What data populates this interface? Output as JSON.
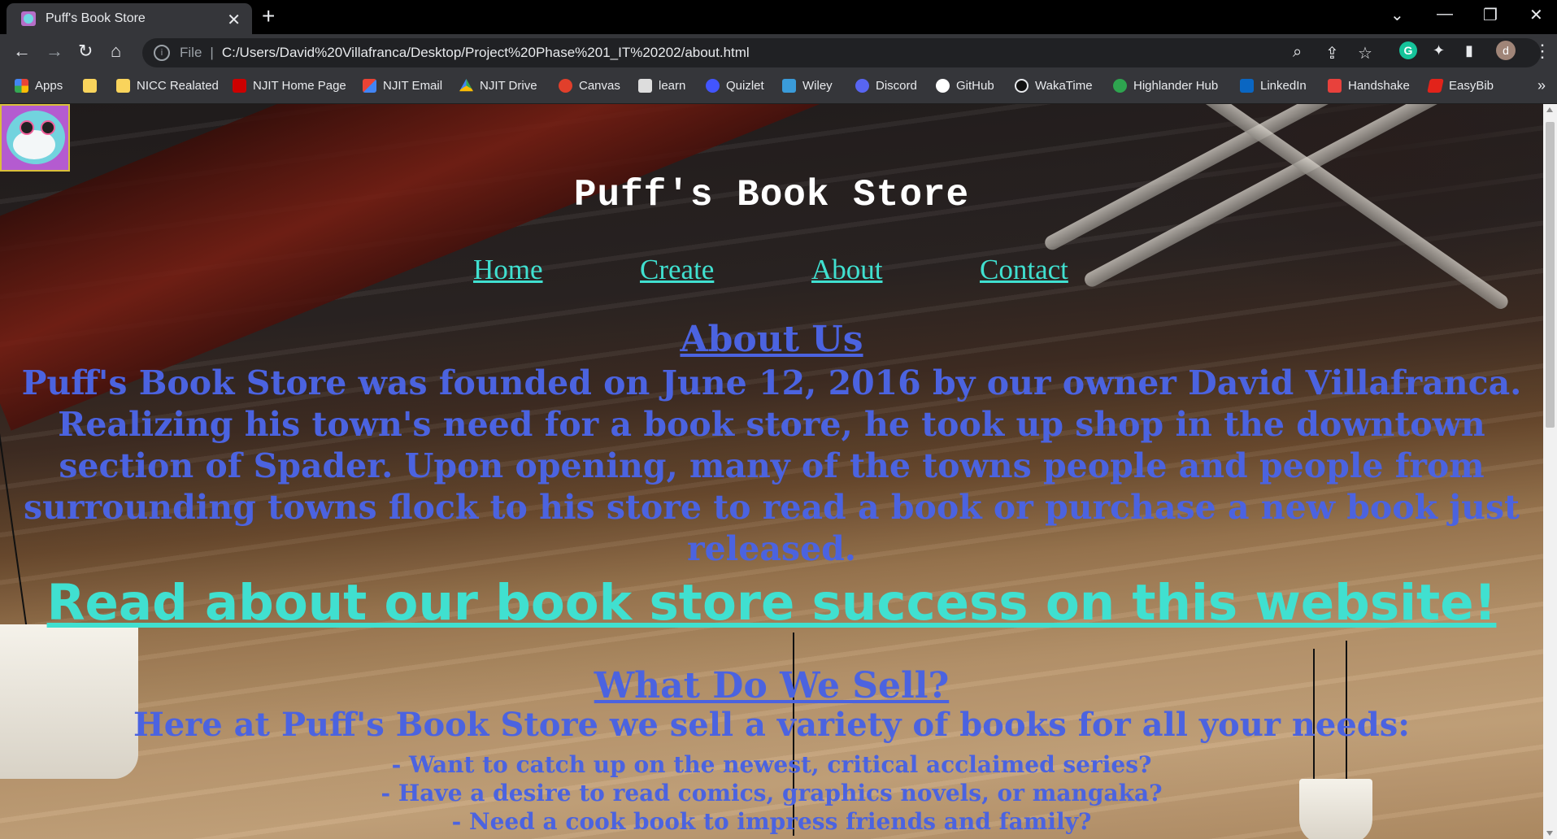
{
  "browser": {
    "tab": {
      "title": "Puff's Book Store",
      "close": "✕",
      "favicon": "pufferfish-favicon"
    },
    "new_tab": "+",
    "window_controls": {
      "dropdown": "⌄",
      "minimize": "—",
      "restore": "❐",
      "close": "✕"
    },
    "toolbar": {
      "back": "←",
      "forward": "→",
      "reload": "↻",
      "home": "⌂",
      "info": "i",
      "scheme": "File",
      "separator": "|",
      "url": "C:/Users/David%20Villafranca/Desktop/Project%20Phase%201_IT%20202/about.html",
      "zoom_icon": "⌕",
      "share_icon": "⇪",
      "star_icon": "☆",
      "grammarly": "G",
      "extensions_icon": "✦",
      "sidepanel_icon": "▮",
      "avatar": "d",
      "menu": "⋮"
    },
    "bookmarks": [
      {
        "label": "Apps",
        "icon": "apps-grid-icon",
        "color": "#e94235"
      },
      {
        "label": "",
        "icon": "folder-icon",
        "color": "#f9d45c"
      },
      {
        "label": "NICC Realated",
        "icon": "folder-icon",
        "color": "#f9d45c"
      },
      {
        "label": "NJIT Home Page",
        "icon": "njit-icon",
        "color": "#cc0000"
      },
      {
        "label": "NJIT Email",
        "icon": "gmail-icon",
        "color": "#ea4335"
      },
      {
        "label": "NJIT Drive",
        "icon": "drive-icon",
        "color": "#34a853"
      },
      {
        "label": "Canvas",
        "icon": "canvas-icon",
        "color": "#e13f2b"
      },
      {
        "label": "learn",
        "icon": "learn-icon",
        "color": "#dddddd"
      },
      {
        "label": "Quizlet",
        "icon": "quizlet-icon",
        "color": "#4255ff"
      },
      {
        "label": "Wiley",
        "icon": "wiley-icon",
        "color": "#3a9bd9"
      },
      {
        "label": "Discord",
        "icon": "discord-icon",
        "color": "#5865f2"
      },
      {
        "label": "GitHub",
        "icon": "github-icon",
        "color": "#ffffff"
      },
      {
        "label": "WakaTime",
        "icon": "wakatime-icon",
        "color": "#111111"
      },
      {
        "label": "Highlander Hub",
        "icon": "highlander-hub-icon",
        "color": "#2ea44f"
      },
      {
        "label": "LinkedIn",
        "icon": "linkedin-icon",
        "color": "#0a66c2"
      },
      {
        "label": "Handshake",
        "icon": "handshake-icon",
        "color": "#e8413c"
      },
      {
        "label": "EasyBib",
        "icon": "easybib-icon",
        "color": "#e2231a"
      }
    ],
    "bookmarks_more": "»"
  },
  "page": {
    "site_title": "Puff's Book Store",
    "nav": [
      "Home",
      "Create",
      "About",
      "Contact"
    ],
    "about_heading": "About Us",
    "about_text": "Puff's Book Store was founded on June 12, 2016 by our owner David Villafranca. Realizing his town's need for a book store, he took up shop in the downtown section of Spader. Upon opening, many of the towns people and people from surrounding towns flock to his store to read a book or purchase a new book just released.",
    "success_link": "Read about our book store success on this website!",
    "sell_heading": "What Do We Sell?",
    "sell_text": "Here at Puff's Book Store we sell a variety of books for all your needs:",
    "sell_items": [
      "- Want to catch up on the newest, critical acclaimed series?",
      "- Have a desire to read comics, graphics novels, or mangaka?",
      "- Need a cook book to impress friends and family?"
    ]
  },
  "colors": {
    "link_turquoise": "#40e0d0",
    "text_blue": "#4b63e0",
    "title_white": "#ffffff"
  }
}
